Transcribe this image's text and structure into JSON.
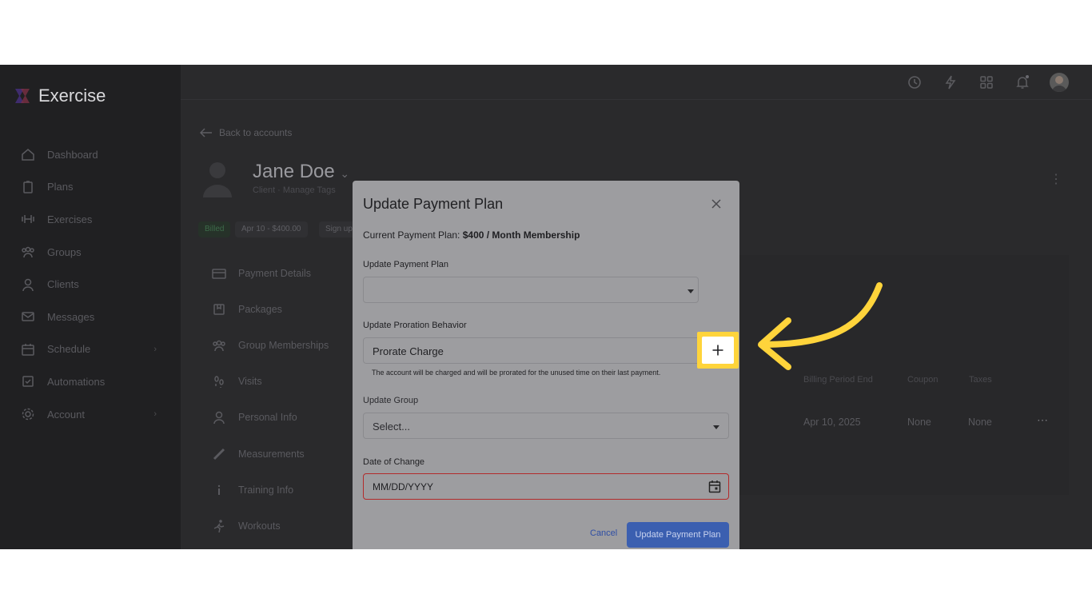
{
  "app": {
    "name": "Exercise"
  },
  "sidebar": {
    "items": [
      {
        "label": "Dashboard",
        "icon": "home-icon"
      },
      {
        "label": "Plans",
        "icon": "clipboard-icon"
      },
      {
        "label": "Exercises",
        "icon": "dumbbell-icon"
      },
      {
        "label": "Groups",
        "icon": "group-icon"
      },
      {
        "label": "Clients",
        "icon": "person-icon"
      },
      {
        "label": "Messages",
        "icon": "mail-icon"
      },
      {
        "label": "Schedule",
        "icon": "calendar-icon",
        "has_submenu": true
      },
      {
        "label": "Automations",
        "icon": "checkbox-icon"
      },
      {
        "label": "Account",
        "icon": "gear-icon",
        "has_submenu": true
      }
    ]
  },
  "content": {
    "back_label": "Back to accounts",
    "client_name": "Jane Doe",
    "client_sub": "Client · Manage Tags",
    "chips": [
      "Billed",
      "Apr 10 - $400.00",
      "Sign up"
    ],
    "side_menu": [
      {
        "label": "Payment Details",
        "icon": "credit-card-icon"
      },
      {
        "label": "Packages",
        "icon": "package-icon"
      },
      {
        "label": "Group Memberships",
        "icon": "group-icon"
      },
      {
        "label": "Visits",
        "icon": "footprints-icon"
      },
      {
        "label": "Personal Info",
        "icon": "person-icon"
      },
      {
        "label": "Measurements",
        "icon": "ruler-icon"
      },
      {
        "label": "Training Info",
        "icon": "info-icon"
      },
      {
        "label": "Workouts",
        "icon": "runner-icon"
      }
    ],
    "table": {
      "headers": [
        "Billing Period End",
        "Coupon",
        "Taxes"
      ],
      "row": [
        "Apr 10, 2025",
        "None",
        "None"
      ]
    }
  },
  "modal": {
    "title": "Update Payment Plan",
    "current_label": "Current Payment Plan:",
    "current_value": "$400 / Month Membership",
    "plan_label": "Update Payment Plan",
    "plan_value": "",
    "proration_label": "Update Proration Behavior",
    "proration_value": "Prorate Charge",
    "proration_help": "The account will be charged and will be prorated for the unused time on their last payment.",
    "group_label": "Update Group",
    "group_placeholder": "Select...",
    "date_label": "Date of Change",
    "date_placeholder": "MM/DD/YYYY",
    "cancel_label": "Cancel",
    "submit_label": "Update Payment Plan"
  },
  "annotation": {
    "highlight_color": "#ffd43b",
    "arrow_color": "#ffd43b"
  }
}
